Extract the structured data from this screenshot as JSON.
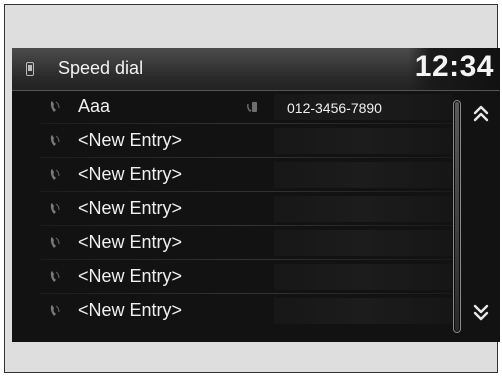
{
  "header": {
    "title": "Speed dial",
    "clock": "12:34",
    "icon": "phone-icon"
  },
  "entries": [
    {
      "label": "Aaa",
      "number": "012-3456-7890",
      "icon": "handset-icon",
      "number_type_icon": "mobile-phone-icon"
    },
    {
      "label": "<New Entry>",
      "icon": "handset-icon"
    },
    {
      "label": "<New Entry>",
      "icon": "handset-icon"
    },
    {
      "label": "<New Entry>",
      "icon": "handset-icon"
    },
    {
      "label": "<New Entry>",
      "icon": "handset-icon"
    },
    {
      "label": "<New Entry>",
      "icon": "handset-icon"
    },
    {
      "label": "<New Entry>",
      "icon": "handset-icon"
    }
  ],
  "scroll": {
    "up_icon": "double-chevron-up-icon",
    "down_icon": "double-chevron-down-icon"
  },
  "colors": {
    "screen_bg": "#121212",
    "text": "#f0f0f0",
    "frame_bg": "#dedede"
  }
}
